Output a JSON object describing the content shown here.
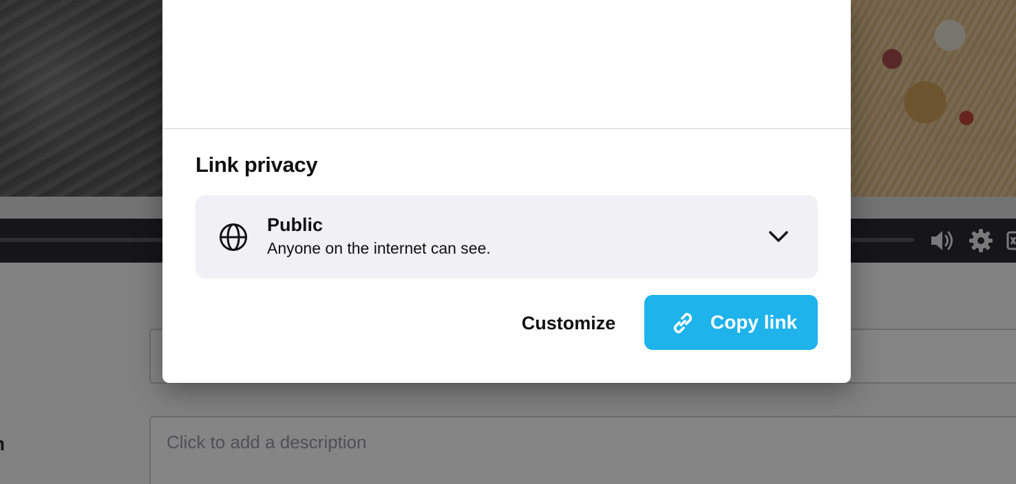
{
  "background": {
    "description_placeholder": "Click to add a description",
    "side_label_fragment": "n"
  },
  "modal": {
    "section_title": "Link privacy",
    "privacy": {
      "selected_label": "Public",
      "selected_description": "Anyone on the internet can see.",
      "icon": "globe-icon",
      "dropdown_icon": "chevron-down-icon"
    },
    "actions": {
      "customize_label": "Customize",
      "copy_label": "Copy link",
      "copy_icon": "link-icon"
    }
  },
  "player": {
    "icons": [
      "volume-icon",
      "settings-gear-icon",
      "captions-icon"
    ]
  },
  "colors": {
    "accent": "#1fb3ec",
    "select_background": "#f0f0f5",
    "text_primary": "#111111"
  }
}
